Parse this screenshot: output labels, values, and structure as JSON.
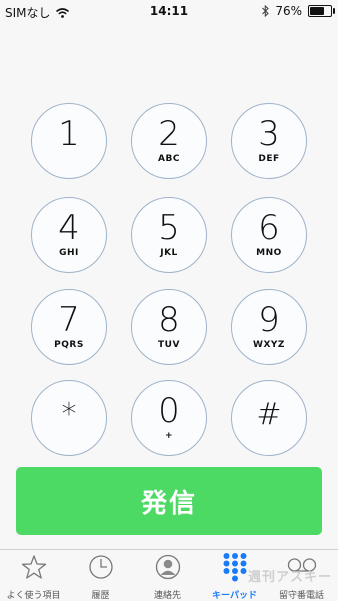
{
  "status_bar": {
    "carrier": "SIMなし",
    "time": "14:11",
    "battery_percent": "76%",
    "battery_level": 0.76,
    "icons": [
      "wifi-icon",
      "bluetooth-icon",
      "battery-icon"
    ]
  },
  "keypad": {
    "keys": [
      {
        "digit": "1",
        "letters": ""
      },
      {
        "digit": "2",
        "letters": "ABC"
      },
      {
        "digit": "3",
        "letters": "DEF"
      },
      {
        "digit": "4",
        "letters": "GHI"
      },
      {
        "digit": "5",
        "letters": "JKL"
      },
      {
        "digit": "6",
        "letters": "MNO"
      },
      {
        "digit": "7",
        "letters": "PQRS"
      },
      {
        "digit": "8",
        "letters": "TUV"
      },
      {
        "digit": "9",
        "letters": "WXYZ"
      },
      {
        "digit": "*",
        "letters": ""
      },
      {
        "digit": "0",
        "letters": "+"
      },
      {
        "digit": "#",
        "letters": ""
      }
    ]
  },
  "call_button": {
    "label": "発信",
    "color": "#4cd964"
  },
  "tab_bar": {
    "accent_color": "#1a7cf5",
    "tabs": [
      {
        "label": "よく使う項目",
        "icon": "star-icon",
        "active": false
      },
      {
        "label": "履歴",
        "icon": "clock-icon",
        "active": false
      },
      {
        "label": "連絡先",
        "icon": "contact-icon",
        "active": false
      },
      {
        "label": "キーパッド",
        "icon": "keypad-icon",
        "active": true
      },
      {
        "label": "留守番電話",
        "icon": "voicemail-icon",
        "active": false
      }
    ]
  },
  "watermark": "週刊アスキー"
}
